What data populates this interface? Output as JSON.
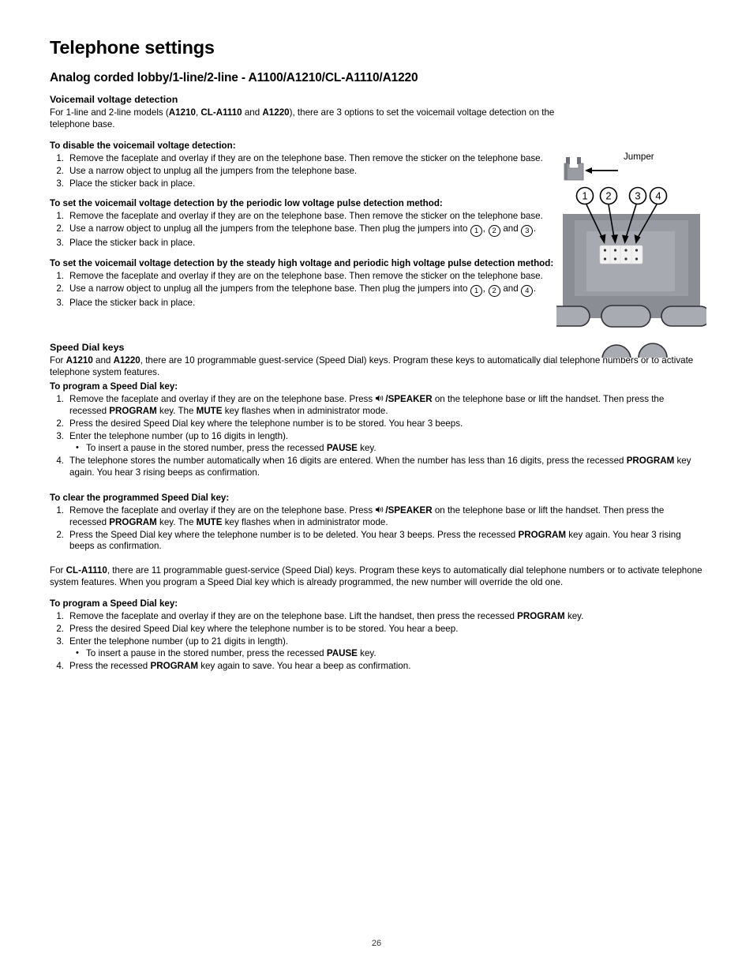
{
  "page": {
    "title": "Telephone settings",
    "section": "Analog corded lobby/1-line/2-line - A1100/A1210/CL-A1110/A1220",
    "folio": "26"
  },
  "voicemail": {
    "heading": "Voicemail voltage detection",
    "intro_1": "For 1-line and 2-line models (",
    "intro_model_1": "A1210",
    "intro_2": ", ",
    "intro_model_2": "CL-A1110",
    "intro_3": " and ",
    "intro_model_3": "A1220",
    "intro_4": "), there are 3 options to set the voicemail voltage detection on the telephone base.",
    "disable": {
      "heading": "To disable the voicemail voltage detection:",
      "steps": [
        {
          "num": "1.",
          "text": "Remove the faceplate and overlay if they are on the telephone base. Then remove the sticker on the telephone base."
        },
        {
          "num": "2.",
          "text": "Use a narrow object to unplug all the jumpers from the telephone base."
        },
        {
          "num": "3.",
          "text": "Place the sticker back in place."
        }
      ]
    },
    "low_pulse": {
      "heading": "To set the voicemail voltage detection by the periodic low voltage pulse detection method:",
      "step1_num": "1.",
      "step1_text": "Remove the faceplate and overlay if they are on the telephone base. Then remove the sticker on the telephone base.",
      "step2_num": "2.",
      "step2_a": "Use a narrow object to unplug all the jumpers from the telephone base. Then plug the jumpers into ",
      "step2_c1": "1",
      "step2_b": ", ",
      "step2_c2": "2",
      "step2_d": " and ",
      "step2_c3": "3",
      "step2_e": ".",
      "step3_num": "3.",
      "step3_text": "Place the sticker back in place."
    },
    "high_pulse": {
      "heading": "To set the voicemail voltage detection by the steady high voltage and periodic high voltage pulse detection method:",
      "step1_num": "1.",
      "step1_text": "Remove the faceplate and overlay if they are on the telephone base. Then remove the sticker on the telephone base.",
      "step2_num": "2.",
      "step2_a": "Use a narrow object to unplug all the jumpers from the telephone base. Then plug the jumpers into ",
      "step2_c1": "1",
      "step2_b": ", ",
      "step2_c2": "2",
      "step2_d": " and ",
      "step2_c3": "4",
      "step2_e": ".",
      "step3_num": "3.",
      "step3_text": "Place the sticker back in place."
    }
  },
  "illustration": {
    "jumper_label": "Jumper",
    "callouts": [
      "1",
      "2",
      "3",
      "4"
    ],
    "colors": {
      "base_dark": "#8b8d94",
      "base_mid": "#9a9ca3",
      "base_light": "#a8aab1",
      "button_fill": "#a9abb2",
      "connector": "#f2f2f2",
      "jumper": "#9a9ca3",
      "jumper_dark": "#6e7077"
    }
  },
  "speed_dial": {
    "heading": "Speed Dial keys",
    "intro_1": "For ",
    "intro_model_1": "A1210",
    "intro_2": " and ",
    "intro_model_2": "A1220",
    "intro_3": ", there are 10 programmable guest-service (Speed Dial) keys. Program these keys to automatically dial telephone numbers or to activate telephone system features.",
    "program": {
      "heading": "To program a Speed Dial key:",
      "s1_num": "1.",
      "s1_a": "Remove the faceplate and overlay if they are on the telephone base. Press ",
      "s1_speaker": "/SPEAKER",
      "s1_b": " on the telephone base or lift the handset. Then press the recessed ",
      "s1_program": "PROGRAM",
      "s1_c": " key. The ",
      "s1_mute": "MUTE",
      "s1_d": " key flashes when in administrator mode.",
      "s2_num": "2.",
      "s2_text": "Press the desired Speed Dial key where the telephone number is to be stored. You hear 3 beeps.",
      "s3_num": "3.",
      "s3_text": "Enter the telephone number (up to 16 digits in length).",
      "s3_bullet_a": "To insert a pause in the stored number, press the recessed ",
      "s3_bullet_pause": "PAUSE",
      "s3_bullet_b": " key.",
      "s4_num": "4.",
      "s4_a": "The telephone stores the number automatically when 16 digits are entered. When the number has less than 16 digits, press the recessed ",
      "s4_program": "PROGRAM",
      "s4_b": " key again. You hear 3 rising beeps as confirmation."
    },
    "clear": {
      "heading": "To clear the programmed Speed Dial key:",
      "s1_num": "1.",
      "s1_a": "Remove the faceplate and overlay if they are on the telephone base. Press ",
      "s1_speaker": "/SPEAKER",
      "s1_b": " on the telephone base or lift the handset. Then press the recessed ",
      "s1_program": "PROGRAM",
      "s1_c": " key. The ",
      "s1_mute": "MUTE",
      "s1_d": " key flashes when in administrator mode.",
      "s2_num": "2.",
      "s2_a": "Press the Speed Dial key where the telephone number is to be deleted. You hear 3 beeps. Press the recessed ",
      "s2_program": "PROGRAM",
      "s2_b": " key again. You hear 3 rising beeps as confirmation."
    }
  },
  "cl_a1110": {
    "intro_1": "For ",
    "intro_model": "CL-A1110",
    "intro_2": ", there are 11 programmable guest-service (Speed Dial) keys. Program these keys to automatically dial telephone numbers or to activate telephone system features. When you program a Speed Dial key which is already programmed, the new number will override the old one.",
    "program": {
      "heading": "To program a Speed Dial key:",
      "s1_num": "1.",
      "s1_a": "Remove the faceplate and overlay if they are on the telephone base. Lift the handset, then press the recessed ",
      "s1_program": "PROGRAM",
      "s1_b": " key.",
      "s2_num": "2.",
      "s2_text": "Press the desired Speed Dial key where the telephone number is to be stored. You hear a beep.",
      "s3_num": "3.",
      "s3_text": "Enter the telephone number (up to 21 digits in length).",
      "s3_bullet_a": "To insert a pause in the stored number, press the recessed ",
      "s3_bullet_pause": "PAUSE",
      "s3_bullet_b": " key.",
      "s4_num": "4.",
      "s4_a": "Press the recessed ",
      "s4_program": "PROGRAM",
      "s4_b": " key again to save. You hear a beep as confirmation."
    }
  }
}
